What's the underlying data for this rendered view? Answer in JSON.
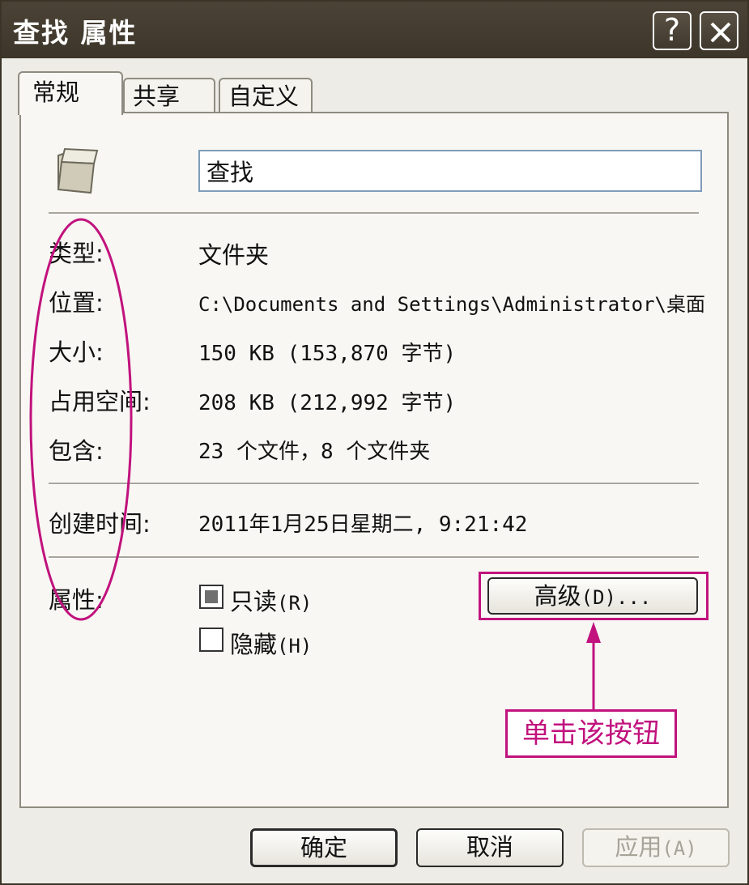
{
  "window": {
    "title": "查找 属性",
    "help_label": "?",
    "close_label": "✕"
  },
  "tabs": [
    {
      "label": "常规"
    },
    {
      "label": "共享"
    },
    {
      "label": "自定义"
    }
  ],
  "general": {
    "folder_name": "查找",
    "rows": [
      {
        "label": "类型:",
        "value": "文件夹"
      },
      {
        "label": "位置:",
        "value": "C:\\Documents and Settings\\Administrator\\桌面"
      },
      {
        "label": "大小:",
        "value": "150 KB (153,870 字节)"
      },
      {
        "label": "占用空间:",
        "value": "208 KB (212,992 字节)"
      },
      {
        "label": "包含:",
        "value": "23 个文件，8 个文件夹"
      }
    ],
    "created": {
      "label": "创建时间:",
      "value": "2011年1月25日星期二, 9:21:42"
    },
    "attributes": {
      "label": "属性:",
      "readonly": {
        "text": "只读",
        "hotkey": "(R)",
        "checked": true
      },
      "hidden": {
        "text": "隐藏",
        "hotkey": "(H)",
        "checked": false
      },
      "advanced_button": {
        "text": "高级",
        "hotkey": "(D)..."
      }
    }
  },
  "footer": {
    "ok": "确定",
    "cancel": "取消",
    "apply": {
      "text": "应用",
      "hotkey": "(A)"
    }
  },
  "annotation": {
    "text": "单击该按钮",
    "color": "#c1127d"
  },
  "icons": [
    "folder-icon",
    "help-icon",
    "close-icon",
    "checkbox-icon"
  ]
}
